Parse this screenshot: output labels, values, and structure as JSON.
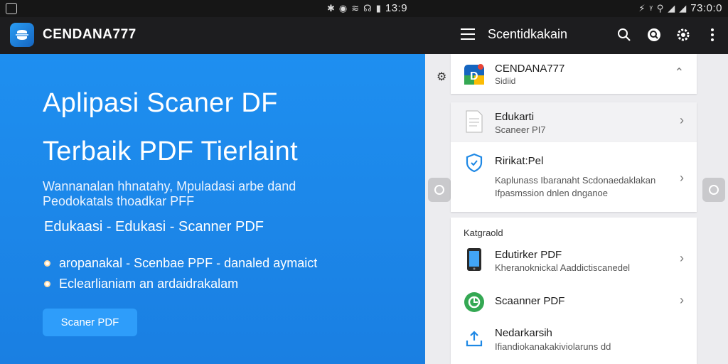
{
  "status_bar": {
    "center_glyphs": [
      "✱",
      "◉",
      "≋",
      "☊",
      "▮"
    ],
    "center_time": "13:9",
    "right_glyphs": [
      "⚡",
      "ᵞ",
      "⚲",
      "◢",
      "◢"
    ],
    "right_time": "73:0:0"
  },
  "appbar": {
    "app_name": "CENDANA777",
    "right_title": "Scentidkakain"
  },
  "hero": {
    "heading_line1": "Aplipasi Scaner DF",
    "heading_line2": "Terbaik PDF Tierlaint",
    "subtitle_line1": "Wannanalan hhnatahy, Mpuladasi arbe dand",
    "subtitle_line2": "Peodokatals thoadkar PFF",
    "tagline": "Edukaasi - Edukasi - Scanner PDF",
    "bullets": [
      "aropanakal - Scenbae PPF - danaled aymaict",
      "Eclearlianiam an ardaidrakalam"
    ],
    "button_label": "Scaner PDF"
  },
  "panel": {
    "header": {
      "title": "CENDANA777",
      "subtitle": "Sidiid"
    },
    "items": [
      {
        "title": "Edukarti",
        "subtitle": "Scaneer PI7"
      },
      {
        "title": "Ririkat:Pel",
        "subtitle_line1": "Kaplunass Ibaranaht Scdonaedaklakan",
        "subtitle_line2": "Ifpasmssion dnlen dnganoe"
      }
    ],
    "category_label": "Katgraold",
    "category_items": [
      {
        "title": "Edutirker PDF",
        "subtitle": "Kheranoknickal Aaddictiscanedel"
      },
      {
        "title": "Scaanner PDF",
        "subtitle": ""
      },
      {
        "title": "Nedarkarsih",
        "subtitle": "Ifiandiokanakakiviolaruns dd"
      }
    ]
  },
  "colors": {
    "hero_bg": "#1e8ff0",
    "appbar_bg": "#1d1d1f",
    "accent": "#2e9dfa"
  }
}
